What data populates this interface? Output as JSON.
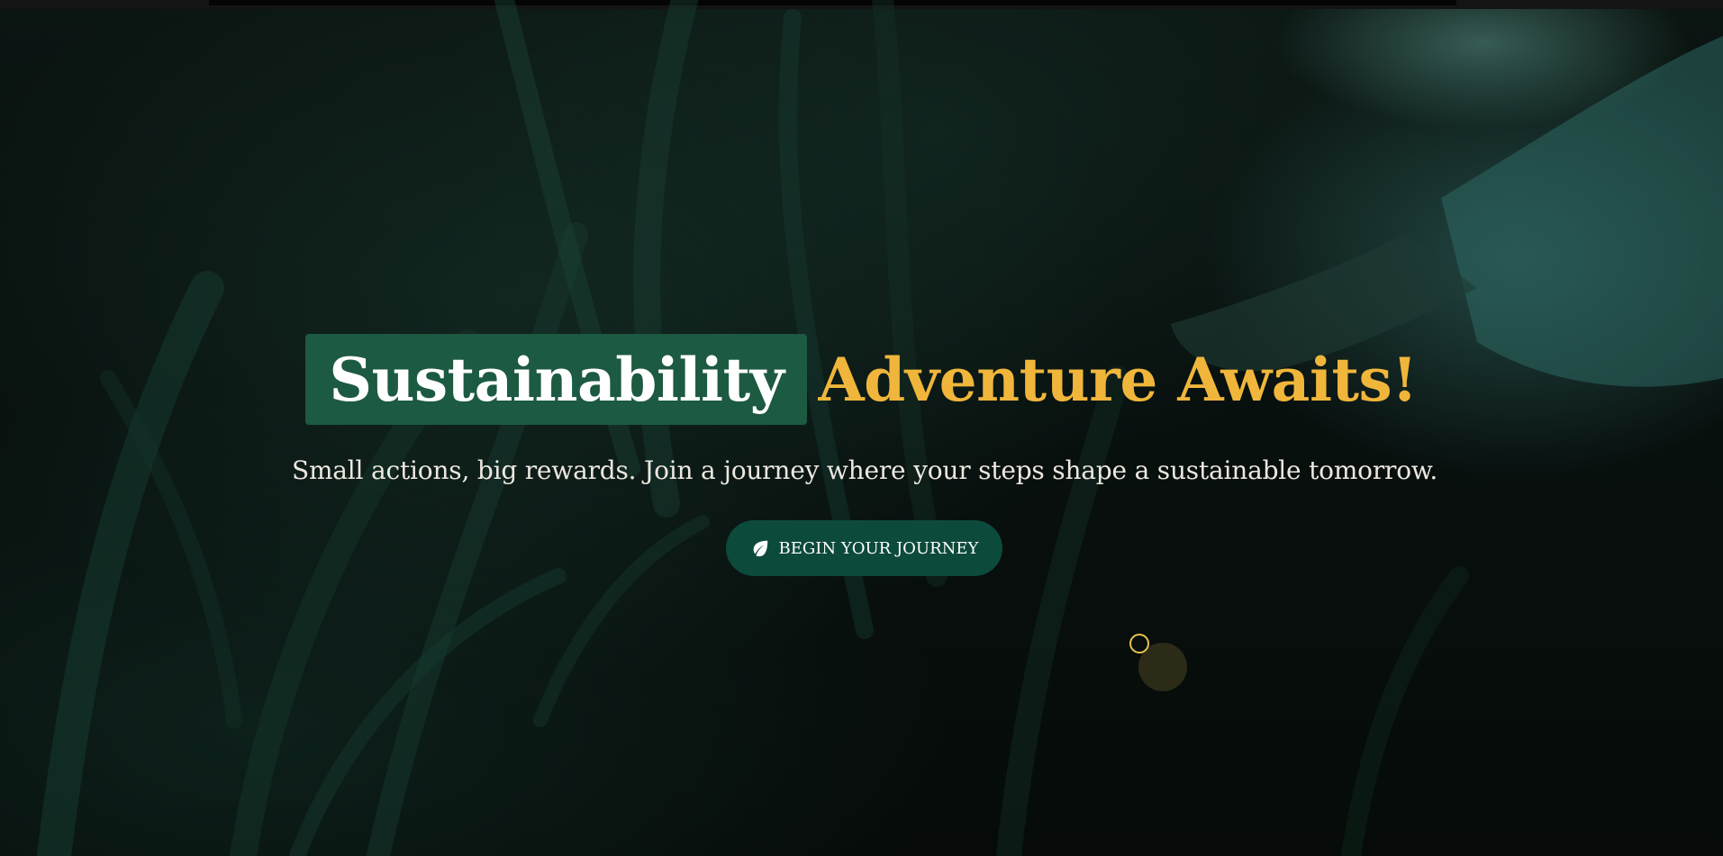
{
  "hero": {
    "title_highlight": "Sustainability",
    "title_rest": "Adventure Awaits!",
    "subtitle": "Small actions, big rewards. Join a journey where your steps shape a sustainable tomorrow.",
    "cta_label": "BEGIN YOUR JOURNEY",
    "cta_icon": "leaf-icon"
  },
  "colors": {
    "highlight_bg": "#1c5a42",
    "accent_text": "#f0b63b",
    "button_bg": "#0c4a3b",
    "cursor_ring": "#e6c34a"
  }
}
